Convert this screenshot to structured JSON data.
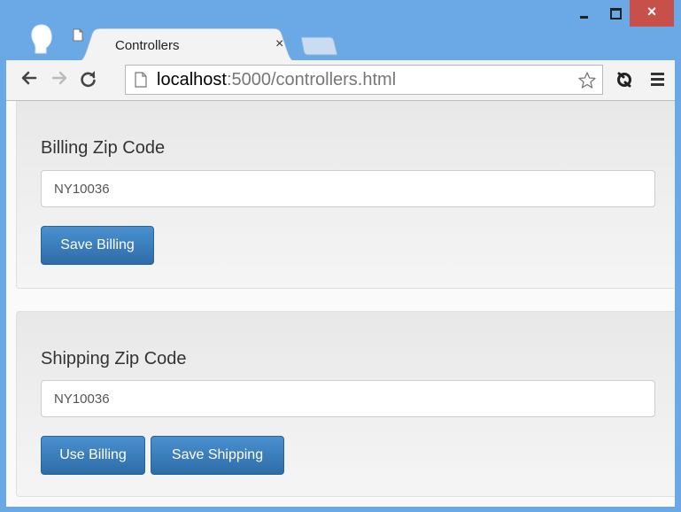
{
  "browser": {
    "tab": {
      "title": "Controllers",
      "close_glyph": "×",
      "icon": "page-icon"
    },
    "window_controls": {
      "close_glyph": "×"
    },
    "address": {
      "host": "localhost",
      "rest": ":5000/controllers.html"
    }
  },
  "billing": {
    "label": "Billing Zip Code",
    "zip_value": "NY10036",
    "save_button": "Save Billing"
  },
  "shipping": {
    "label": "Shipping Zip Code",
    "zip_value": "NY10036",
    "use_billing_button": "Use Billing",
    "save_button": "Save Shipping"
  },
  "colors": {
    "frame": "#6aa8e6",
    "close_button": "#c7504b",
    "primary_button": "#337ab7"
  }
}
